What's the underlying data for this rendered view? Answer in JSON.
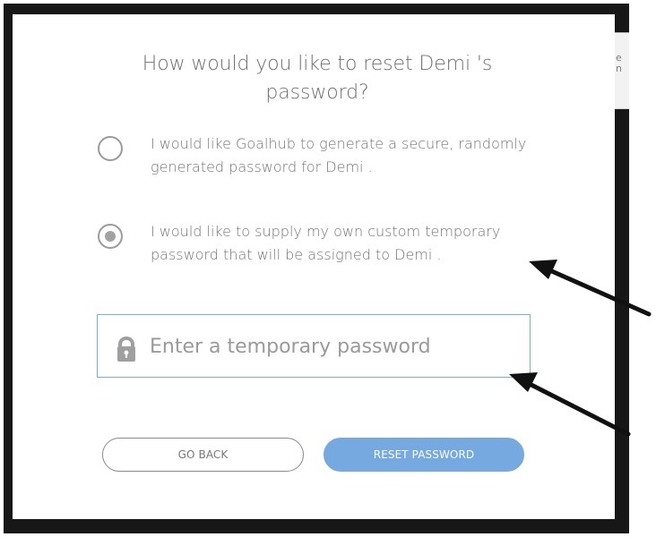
{
  "background_peek": {
    "lines": [
      "e",
      "n"
    ]
  },
  "dialog": {
    "title": "How would you like to reset Demi 's password?",
    "options": [
      {
        "label": "I would like Goalhub to generate a secure, randomly generated password for Demi .",
        "selected": false
      },
      {
        "label": "I would like to supply my own custom temporary password that will be assigned to Demi .",
        "selected": true
      }
    ],
    "password_field": {
      "placeholder": "Enter a temporary password",
      "value": "",
      "icon": "lock-icon"
    },
    "buttons": {
      "back": "GO BACK",
      "reset": "RESET PASSWORD"
    }
  },
  "annotations": [
    {
      "icon": "arrow-icon",
      "target": "option-custom-password"
    },
    {
      "icon": "arrow-icon",
      "target": "temporary-password-input"
    }
  ],
  "colors": {
    "overlay": "#171717",
    "dialog_background": "#ffffff",
    "input_border": "#74b0e0",
    "reset_button": "#76a9e0",
    "text": "#747474",
    "radio": "#a2a2a2"
  }
}
